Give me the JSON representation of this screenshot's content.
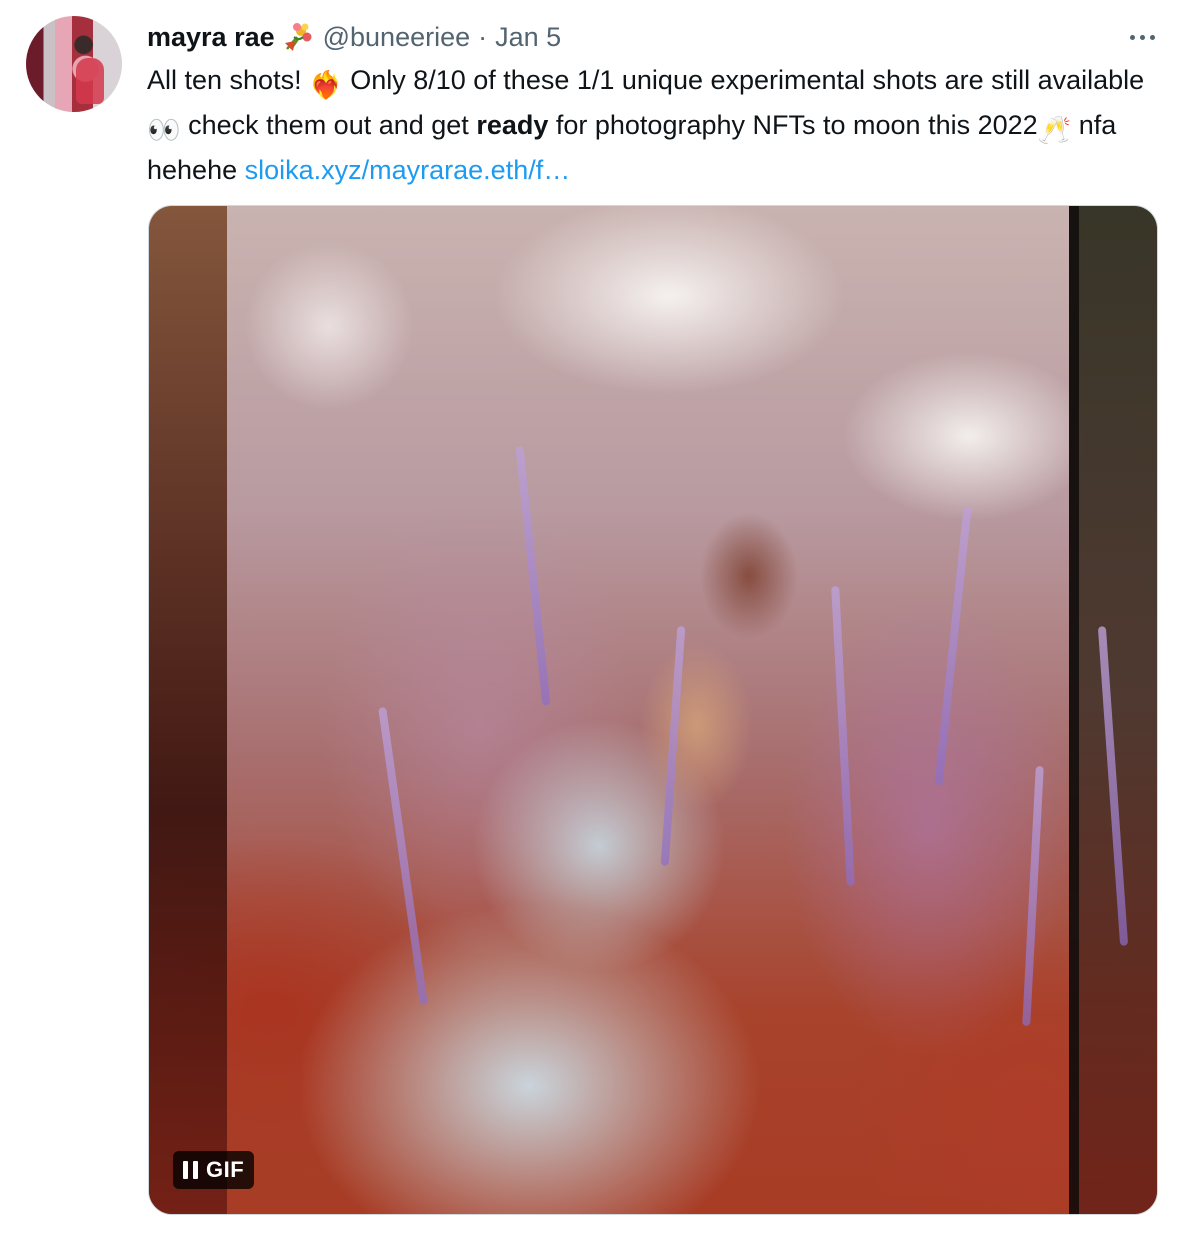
{
  "tweet": {
    "author": {
      "name": "mayra rae",
      "name_emoji": "bouquet",
      "handle": "@buneeriee",
      "separator": "·",
      "date": "Jan 5"
    },
    "body": {
      "part1": "All ten shots! ",
      "emoji_fire_heart": "❤️‍🔥",
      "part2": " Only 8/10 of these 1/1 unique experimental shots are still available ",
      "emoji_eyes": "👀",
      "part3": " check them out and get ",
      "bold": "ready",
      "part4": " for photography NFTs to moon this 2022",
      "emoji_cheers": "🥂",
      "part5": " nfa hehehe ",
      "link": "sloika.xyz/mayrarae.eth/f…"
    },
    "media": {
      "badge_label": "GIF",
      "pause_icon": "pause-icon"
    }
  }
}
